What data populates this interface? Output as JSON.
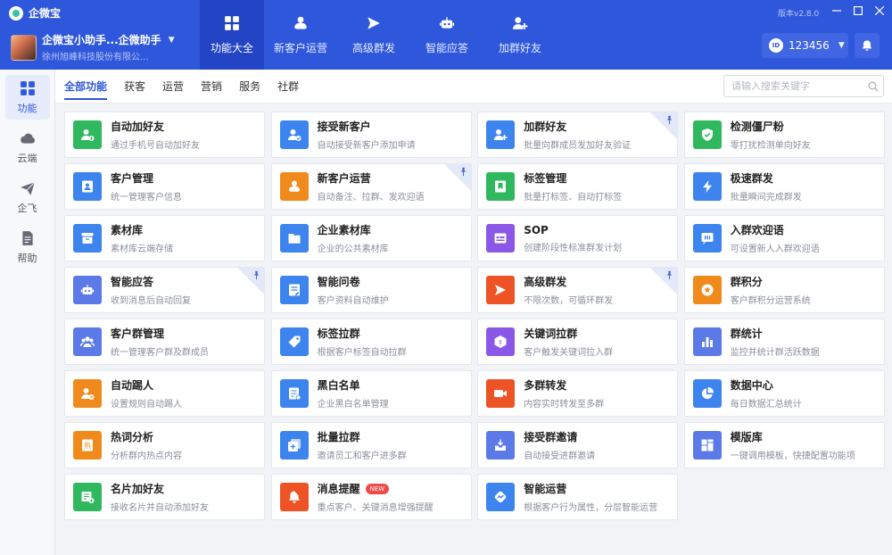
{
  "app": {
    "title": "企微宝",
    "version": "版本v2.8.0"
  },
  "user": {
    "name": "企微宝小助手...企微助手",
    "company": "徐州旭峰科技股份有限公..."
  },
  "account_id": "123456",
  "nav": [
    {
      "label": "功能大全",
      "icon": "grid-icon",
      "active": true
    },
    {
      "label": "新客户运营",
      "icon": "user-new-icon"
    },
    {
      "label": "高级群发",
      "icon": "send-icon"
    },
    {
      "label": "智能应答",
      "icon": "robot-icon"
    },
    {
      "label": "加群好友",
      "icon": "group-add-icon"
    }
  ],
  "sidebar": [
    {
      "label": "功能",
      "icon": "grid-icon",
      "active": true
    },
    {
      "label": "云端",
      "icon": "cloud-icon"
    },
    {
      "label": "企飞",
      "icon": "plane-icon"
    },
    {
      "label": "帮助",
      "icon": "document-icon"
    }
  ],
  "tabs": [
    "全部功能",
    "获客",
    "运营",
    "营销",
    "服务",
    "社群"
  ],
  "search": {
    "placeholder": "请输入搜索关键字"
  },
  "colors": {
    "header": "#2f57dc",
    "green": "#2fb85e",
    "blue": "#3d84ee",
    "indigo": "#5c79e8",
    "orange": "#f08a1c",
    "red": "#ee5325",
    "purple": "#8a57e6"
  },
  "features": [
    {
      "title": "自动加好友",
      "desc": "通过手机号自动加好友",
      "color": "#2fb85e",
      "icon": "user-add-icon"
    },
    {
      "title": "接受新客户",
      "desc": "自动接受新客户添加申请",
      "color": "#3d84ee",
      "icon": "user-check-icon"
    },
    {
      "title": "加群好友",
      "desc": "批量向群成员发加好友验证",
      "color": "#3d84ee",
      "icon": "group-add-icon",
      "pinned": true
    },
    {
      "title": "检测僵尸粉",
      "desc": "零打扰检测单向好友",
      "color": "#2fb85e",
      "icon": "shield-icon"
    },
    {
      "title": "客户管理",
      "desc": "统一管理客户信息",
      "color": "#3d84ee",
      "icon": "contact-card-icon"
    },
    {
      "title": "新客户运营",
      "desc": "自动备注、拉群、发欢迎语",
      "color": "#f08a1c",
      "icon": "user-new-icon",
      "pinned": true
    },
    {
      "title": "标签管理",
      "desc": "批量打标签、自动打标签",
      "color": "#2fb85e",
      "icon": "bookmark-icon"
    },
    {
      "title": "极速群发",
      "desc": "批量瞬间完成群发",
      "color": "#3d84ee",
      "icon": "lightning-icon"
    },
    {
      "title": "素材库",
      "desc": "素材库云端存储",
      "color": "#3d84ee",
      "icon": "archive-icon"
    },
    {
      "title": "企业素材库",
      "desc": "企业的公共素材库",
      "color": "#3d84ee",
      "icon": "folder-icon"
    },
    {
      "title": "SOP",
      "desc": "创建阶段性标准群发计划",
      "color": "#8a57e6",
      "icon": "calendar-icon"
    },
    {
      "title": "入群欢迎语",
      "desc": "可设置新人入群欢迎语",
      "color": "#3d84ee",
      "icon": "hi-message-icon"
    },
    {
      "title": "智能应答",
      "desc": "收到消息后自动回复",
      "color": "#5c79e8",
      "icon": "robot-icon",
      "pinned": true
    },
    {
      "title": "智能问卷",
      "desc": "客户资料自动维护",
      "color": "#3d84ee",
      "icon": "form-icon"
    },
    {
      "title": "高级群发",
      "desc": "不限次数，可循环群发",
      "color": "#ee5325",
      "icon": "send-icon",
      "pinned": true
    },
    {
      "title": "群积分",
      "desc": "客户群积分运营系统",
      "color": "#f08a1c",
      "icon": "star-badge-icon"
    },
    {
      "title": "客户群管理",
      "desc": "统一管理客户群及群成员",
      "color": "#5c79e8",
      "icon": "group-icon"
    },
    {
      "title": "标签拉群",
      "desc": "根据客户标签自动拉群",
      "color": "#3d84ee",
      "icon": "tag-icon"
    },
    {
      "title": "关键词拉群",
      "desc": "客户触发关键词拉入群",
      "color": "#8a57e6",
      "icon": "keyword-icon"
    },
    {
      "title": "群统计",
      "desc": "监控并统计群活跃数据",
      "color": "#5c79e8",
      "icon": "bar-chart-icon"
    },
    {
      "title": "自动踢人",
      "desc": "设置规则自动踢人",
      "color": "#f08a1c",
      "icon": "user-remove-icon"
    },
    {
      "title": "黑白名单",
      "desc": "企业黑白名单管理",
      "color": "#3d84ee",
      "icon": "list-check-icon"
    },
    {
      "title": "多群转发",
      "desc": "内容实时转发至多群",
      "color": "#ee5325",
      "icon": "video-icon"
    },
    {
      "title": "数据中心",
      "desc": "每日数据汇总统计",
      "color": "#3d84ee",
      "icon": "pie-chart-icon"
    },
    {
      "title": "热词分析",
      "desc": "分析群内热点内容",
      "color": "#f08a1c",
      "icon": "hot-word-icon"
    },
    {
      "title": "批量拉群",
      "desc": "邀请员工和客户进多群",
      "color": "#3d84ee",
      "icon": "add-square-icon"
    },
    {
      "title": "接受群邀请",
      "desc": "自动接受进群邀请",
      "color": "#5c79e8",
      "icon": "inbox-icon"
    },
    {
      "title": "模版库",
      "desc": "一键调用模板，快捷配置功能项",
      "color": "#5c79e8",
      "icon": "template-icon"
    },
    {
      "title": "名片加好友",
      "desc": "接收名片并自动添加好友",
      "color": "#2fb85e",
      "icon": "card-add-icon"
    },
    {
      "title": "消息提醒",
      "desc": "重点客户、关键消息增强提醒",
      "color": "#ee5325",
      "icon": "bell-icon",
      "badge": "NEW"
    },
    {
      "title": "智能运营",
      "desc": "根据客户行为属性，分层智能运营",
      "color": "#3d84ee",
      "icon": "smart-ops-icon"
    }
  ]
}
